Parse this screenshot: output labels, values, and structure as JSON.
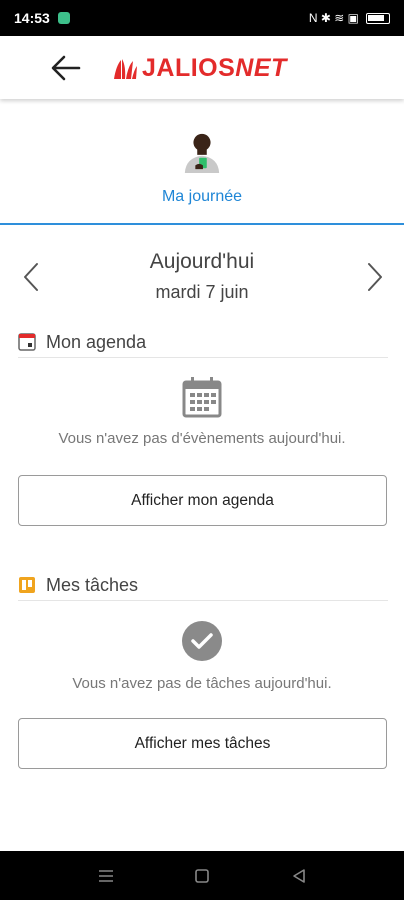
{
  "status_bar": {
    "time": "14:53",
    "indicators": "N ✱ ≋ ▣"
  },
  "header": {
    "logo_text_main": "JALIOS",
    "logo_text_net": "NET",
    "brand_color": "#e32b2b"
  },
  "profile": {
    "label": "Ma journée",
    "accent_color": "#1f86d6"
  },
  "date_nav": {
    "today_label": "Aujourd'hui",
    "date_label": "mardi 7 juin"
  },
  "agenda": {
    "title": "Mon agenda",
    "empty_message": "Vous n'avez pas d'évènements aujourd'hui.",
    "button_label": "Afficher mon agenda"
  },
  "tasks": {
    "title": "Mes tâches",
    "empty_message": "Vous n'avez pas de tâches aujourd'hui.",
    "button_label": "Afficher mes tâches"
  }
}
